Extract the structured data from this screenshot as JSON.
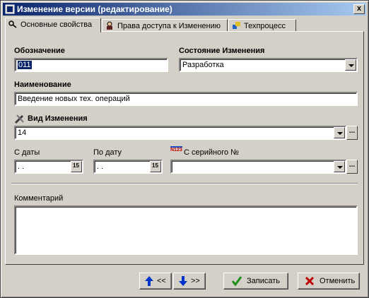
{
  "window": {
    "title": "Изменение версии (редактирование)",
    "close_glyph": "x"
  },
  "tabs": [
    {
      "label": "Основные свойства",
      "icon": "key-icon",
      "active": true
    },
    {
      "label": "Права доступа к Изменению",
      "icon": "user-icon",
      "active": false
    },
    {
      "label": "Техпроцесс",
      "icon": "process-icon",
      "active": false
    }
  ],
  "form": {
    "designation": {
      "label": "Обозначение",
      "value": "011"
    },
    "state": {
      "label": "Состояние Изменения",
      "value": "Разработка"
    },
    "name": {
      "label": "Наименование",
      "value": "Введение новых тех. операций"
    },
    "change_type": {
      "label": "Вид Изменения",
      "value": "14",
      "icon": "tools-icon"
    },
    "date_from": {
      "label": "С даты",
      "value": " .  ."
    },
    "date_to": {
      "label": "По дату",
      "value": " .  ."
    },
    "calendar_glyph": "15",
    "serial_from": {
      "label": "С серийного №",
      "value": "",
      "icon": "serial-number-icon",
      "icon_text": "N123"
    },
    "comment": {
      "label": "Комментарий",
      "value": ""
    },
    "ellipsis": "..."
  },
  "footer": {
    "prev_label": "<<",
    "next_label": ">>",
    "save_label": "Записать",
    "cancel_label": "Отменить"
  },
  "colors": {
    "title_start": "#0a246a",
    "title_end": "#a6caf0",
    "face": "#d4d0c8",
    "arrow": "#0033cc",
    "check": "#1a8f1a",
    "cross": "#c00000"
  }
}
